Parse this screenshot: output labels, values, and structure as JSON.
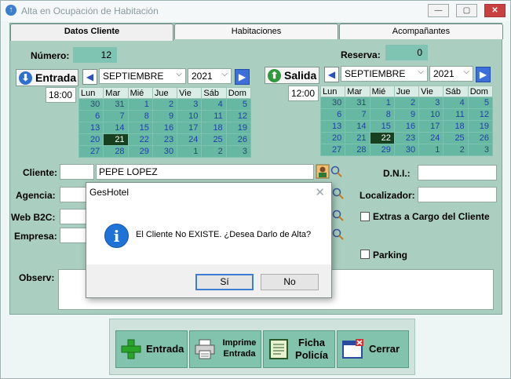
{
  "window": {
    "title": "Alta en Ocupación de Habitación",
    "minimize": "—",
    "maximize": "▢",
    "close": "✕"
  },
  "tabs": [
    "Datos Cliente",
    "Habitaciones",
    "Acompañantes"
  ],
  "form": {
    "numero_label": "Número:",
    "numero_value": "12",
    "reserva_label": "Reserva:",
    "reserva_value": "0",
    "cliente_label": "Cliente:",
    "cliente_value": "PEPE LOPEZ",
    "agencia_label": "Agencia:",
    "webb2c_label": "Web B2C:",
    "empresa_label": "Empresa:",
    "dni_label": "D.N.I.:",
    "localizador_label": "Localizador:",
    "extras_label": "Extras a Cargo del Cliente",
    "parking_label": "Parking",
    "observ_label": "Observ:"
  },
  "entrada": {
    "label": "Entrada",
    "time": "18:00",
    "month": "SEPTIEMBRE",
    "year": "2021",
    "days_header": [
      "Lun",
      "Mar",
      "Mié",
      "Jue",
      "Vie",
      "Sáb",
      "Dom"
    ],
    "weeks": [
      [
        "30",
        "31",
        "1",
        "2",
        "3",
        "4",
        "5"
      ],
      [
        "6",
        "7",
        "8",
        "9",
        "10",
        "11",
        "12"
      ],
      [
        "13",
        "14",
        "15",
        "16",
        "17",
        "18",
        "19"
      ],
      [
        "20",
        "21",
        "22",
        "23",
        "24",
        "25",
        "26"
      ],
      [
        "27",
        "28",
        "29",
        "30",
        "1",
        "2",
        "3"
      ]
    ]
  },
  "salida": {
    "label": "Salida",
    "time": "12:00",
    "month": "SEPTIEMBRE",
    "year": "2021",
    "days_header": [
      "Lun",
      "Mar",
      "Mié",
      "Jue",
      "Vie",
      "Sáb",
      "Dom"
    ],
    "weeks": [
      [
        "30",
        "31",
        "1",
        "2",
        "3",
        "4",
        "5"
      ],
      [
        "6",
        "7",
        "8",
        "9",
        "10",
        "11",
        "12"
      ],
      [
        "13",
        "14",
        "15",
        "16",
        "17",
        "18",
        "19"
      ],
      [
        "20",
        "21",
        "22",
        "23",
        "24",
        "25",
        "26"
      ],
      [
        "27",
        "28",
        "29",
        "30",
        "1",
        "2",
        "3"
      ]
    ]
  },
  "buttons": {
    "entrada": "Entrada",
    "imprime_line1": "Imprime",
    "imprime_line2": "Entrada",
    "ficha_line1": "Ficha",
    "ficha_line2": "Policía",
    "cerrar": "Cerrar"
  },
  "dialog": {
    "title": "GesHotel",
    "close": "✕",
    "icon": "i",
    "message": "El Cliente No EXISTE. ¿Desea Darlo de Alta?",
    "yes": "Sí",
    "no": "No"
  },
  "icons": {
    "nav_prev": "◀",
    "nav_next": "▶",
    "dropdown": "⌵",
    "entrada": "⬇",
    "salida": "⬆"
  },
  "colors": {
    "form_bg": "#aacfc0",
    "calendar_cell": "#67b8a2",
    "selected_day": "#16401f",
    "info_blue": "#1f73d6"
  }
}
